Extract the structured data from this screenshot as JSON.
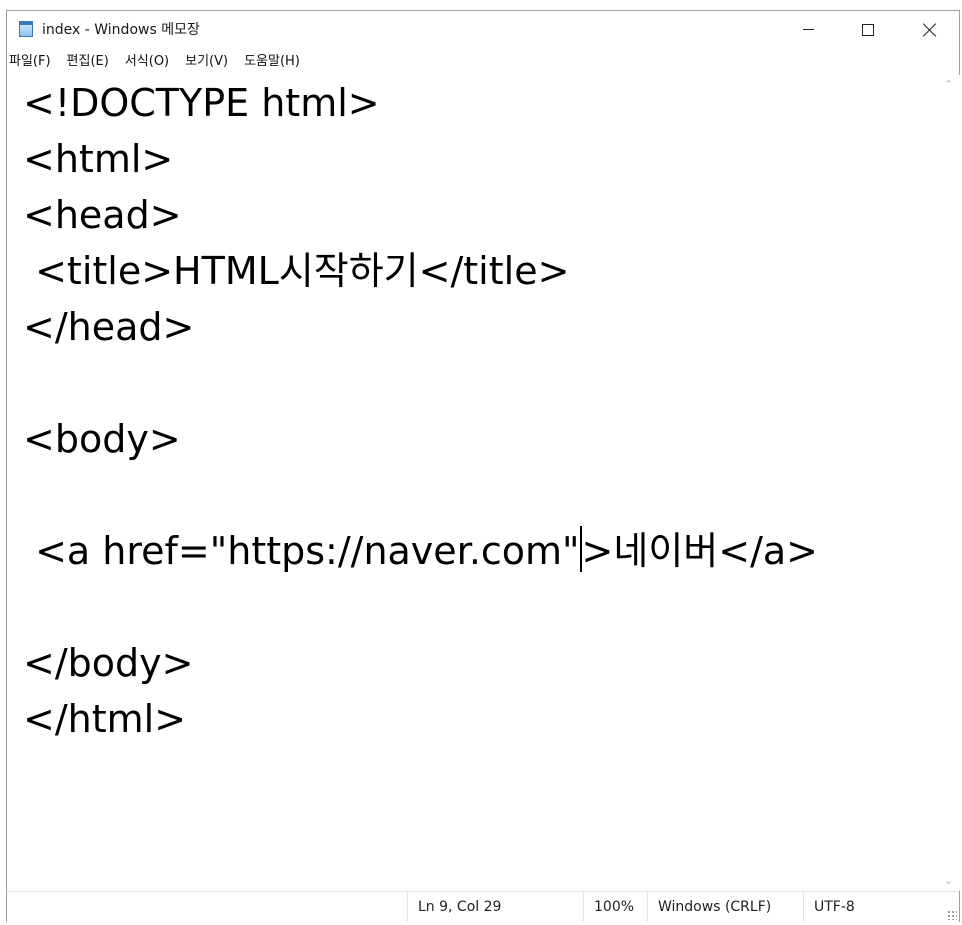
{
  "window": {
    "title": "index - Windows 메모장",
    "icon": "notepad-icon",
    "controls": {
      "minimize": "minimize-icon",
      "maximize": "maximize-icon",
      "close": "close-icon"
    }
  },
  "menu": [
    {
      "label": "파일(F)"
    },
    {
      "label": "편집(E)"
    },
    {
      "label": "서식(O)"
    },
    {
      "label": "보기(V)"
    },
    {
      "label": "도움말(H)"
    }
  ],
  "editor": {
    "lines": [
      "<!DOCTYPE html>",
      "<html>",
      "<head>",
      " <title>HTML시작하기</title>",
      "</head>",
      "",
      "<body>",
      "",
      " <a href=\"https://naver.com\">네이버</a>",
      "",
      "</body>",
      "</html>"
    ],
    "caret_line_before": " <a href=\"https://naver.com\"",
    "caret_line_after": ">네이버</a>"
  },
  "status": {
    "position": "Ln 9, Col 29",
    "zoom": "100%",
    "line_ending": "Windows (CRLF)",
    "encoding": "UTF-8"
  },
  "colors": {
    "background": "#ffffff",
    "text": "#000000",
    "border": "#9e9e9e"
  }
}
